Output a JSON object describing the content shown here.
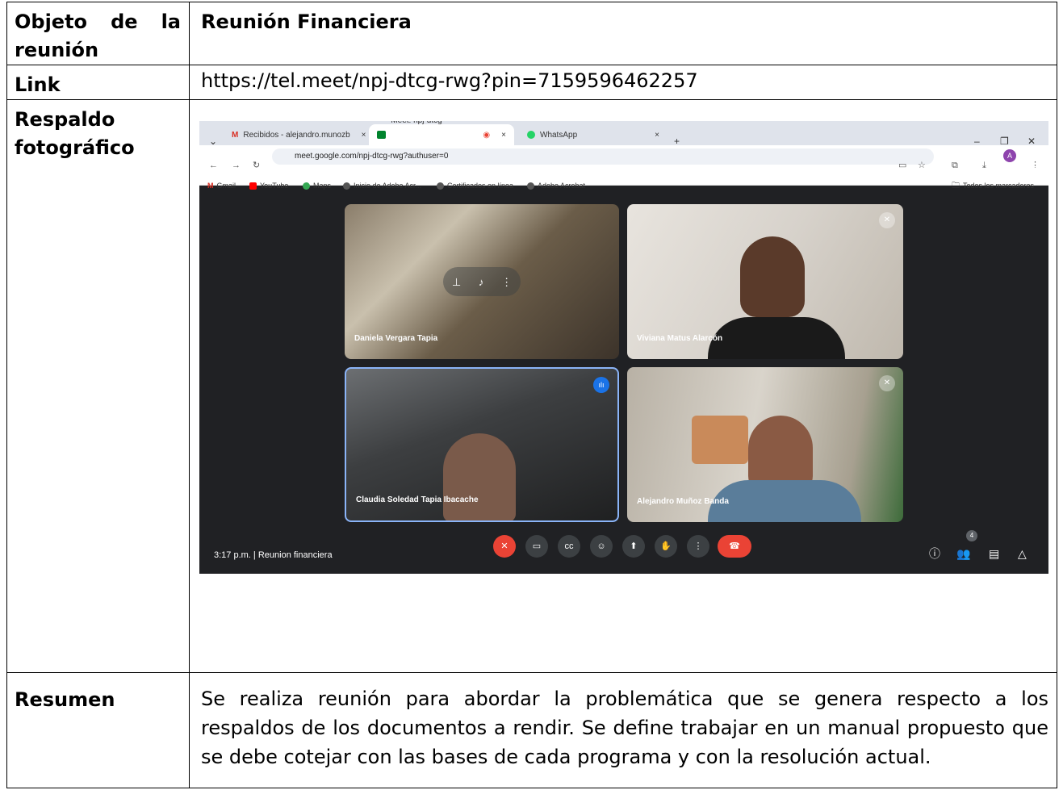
{
  "rows": {
    "objeto": {
      "label": "Objeto de la reunión",
      "value": "Reunión Financiera"
    },
    "link": {
      "label": "Link",
      "value": "https://tel.meet/npj-dtcg-rwg?pin=7159596462257"
    },
    "respaldo": {
      "label": "Respaldo fotográfico"
    },
    "resumen": {
      "label": "Resumen",
      "value": "Se realiza reunión para abordar la problemática que se genera respecto a los respaldos de los documentos a rendir. Se define trabajar en un manual propuesto que se debe cotejar con las bases de cada programa y con la resolución actual."
    }
  },
  "screenshot": {
    "tabs": [
      {
        "title": "Recibidos - alejandro.munozb",
        "close": "×"
      },
      {
        "title": "Meet: npj-dtcg-rwg",
        "close": "×"
      },
      {
        "title": "WhatsApp",
        "close": "×"
      }
    ],
    "new_tab": "+",
    "url": "meet.google.com/npj-dtcg-rwg?authuser=0",
    "avatar_letter": "A",
    "bookmarks": [
      "Gmail",
      "YouTube",
      "Maps",
      "Inicio de Adobe Acr...",
      "Certificados en línea",
      "Adobe Acrobat"
    ],
    "all_bookmarks": "Todos los marcadores",
    "participants": [
      {
        "name": "Daniela Vergara Tapia"
      },
      {
        "name": "Viviana Matus Alarcón"
      },
      {
        "name": "Claudia Soledad Tapia Ibacache"
      },
      {
        "name": "Alejandro Muñoz Banda"
      }
    ],
    "time": "3:17 p.m.",
    "meeting_name": "Reunion financiera",
    "participant_count": "4",
    "colors": {
      "speaking_border": "#8ab4f8",
      "end_call": "#ea4335",
      "meet_bg": "#202124"
    }
  }
}
